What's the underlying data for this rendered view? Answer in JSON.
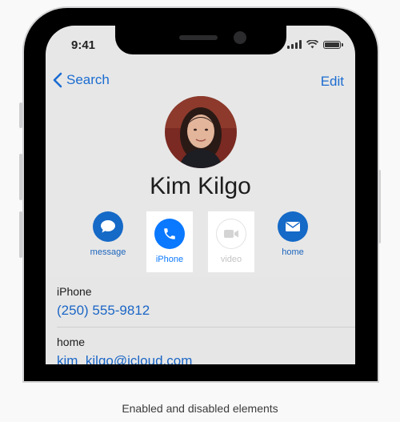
{
  "status_bar": {
    "time": "9:41"
  },
  "nav": {
    "back_label": "Search",
    "edit_label": "Edit"
  },
  "contact": {
    "name": "Kim Kilgo"
  },
  "actions": [
    {
      "label": "message",
      "icon": "message-bubble-icon",
      "state": "enabled"
    },
    {
      "label": "iPhone",
      "icon": "phone-icon",
      "state": "highlighted"
    },
    {
      "label": "video",
      "icon": "video-camera-icon",
      "state": "disabled"
    },
    {
      "label": "home",
      "icon": "envelope-icon",
      "state": "enabled"
    }
  ],
  "details": [
    {
      "label": "iPhone",
      "value": "(250) 555-9812"
    },
    {
      "label": "home",
      "value": "kim_kilgo@icloud.com"
    }
  ],
  "caption": "Enabled and disabled elements",
  "colors": {
    "accent": "#1b6cd1",
    "highlight": "#0a78ff",
    "disabled": "#c4c4c4"
  }
}
